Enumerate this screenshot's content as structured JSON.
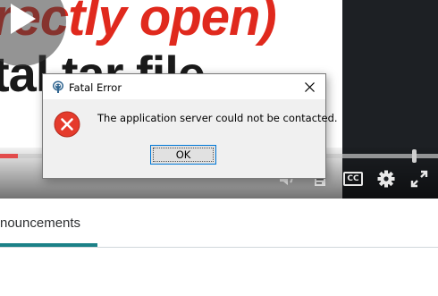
{
  "video": {
    "headline": "rectly open)",
    "subline": "tal tar file",
    "progress_fraction": 0.04,
    "controls": [
      "volume-icon",
      "transcript-icon",
      "captions-icon",
      "settings-icon",
      "fullscreen-icon"
    ],
    "captions_label": "CC"
  },
  "tabs": {
    "active_label": "nouncements"
  },
  "dialog": {
    "title": "Fatal Error",
    "message": "The application server could not be contacted.",
    "ok_label": "OK",
    "icon": "error-icon",
    "title_icon": "elephant-icon"
  },
  "colors": {
    "headline": "#e0291d",
    "progress": "#e24b4b",
    "tab_accent": "#1b8187",
    "error_red": "#e53b2c"
  }
}
